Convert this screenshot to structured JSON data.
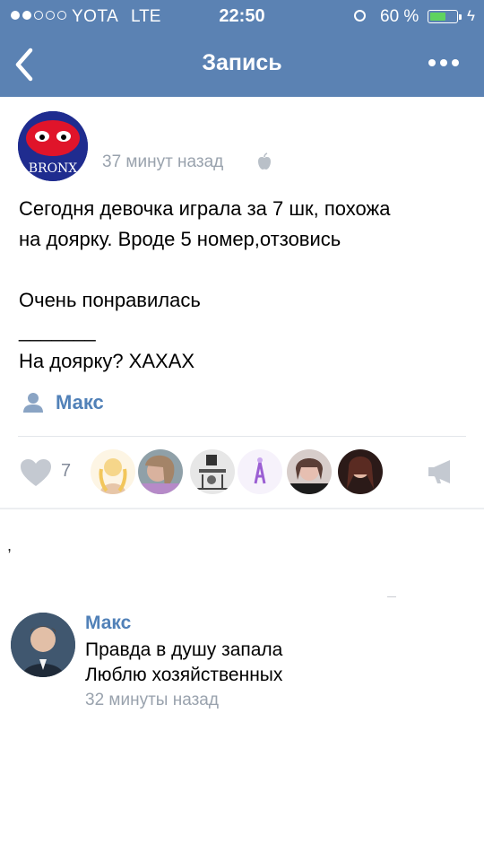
{
  "status_bar": {
    "carrier": "YOTA",
    "network": "LTE",
    "time": "22:50",
    "battery_percent": "60 %",
    "battery_level": 0.6,
    "signal_bars": 2,
    "signal_total": 5
  },
  "nav": {
    "title": "Запись",
    "back_icon": "chevron-left-icon",
    "more_icon": "more-dots-icon"
  },
  "post": {
    "time": "37 минут назад",
    "platform_icon": "apple-icon",
    "text_lines": [
      "Сегодня девочка играла за 7 шк, похожа",
      "на доярку. Вроде 5 номер,отзовись",
      "",
      "Очень понравилась",
      "_______",
      "На доярку? ХАХАХ"
    ],
    "signed_by": "Макс",
    "likes": "7",
    "likers_count": 6
  },
  "comment": {
    "author": "Макс",
    "lines": [
      "Правда в душу запала",
      "Люблю хозяйственных"
    ],
    "time": "32 минуты назад"
  },
  "colors": {
    "header": "#5b82b3",
    "link": "#5181b8",
    "meta": "#99a2ad",
    "icon_gray": "#c4c9d1"
  }
}
